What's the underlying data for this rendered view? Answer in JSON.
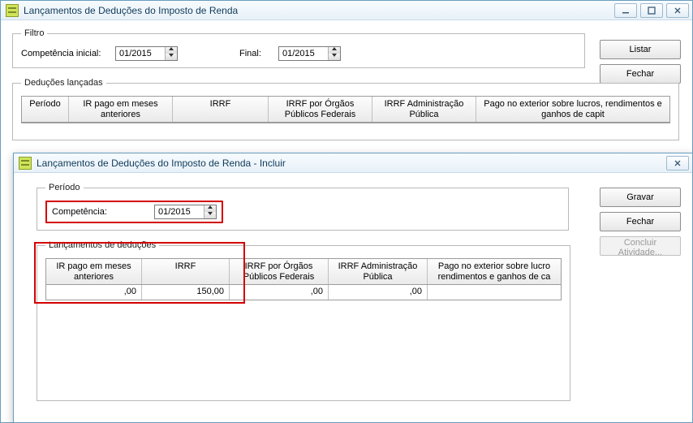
{
  "parent": {
    "title": "Lançamentos de Deduções do Imposto de Renda",
    "filter": {
      "legend": "Filtro",
      "initial_label": "Competência inicial:",
      "initial_value": "01/2015",
      "final_label": "Final:",
      "final_value": "01/2015"
    },
    "buttons": {
      "list": "Listar",
      "close": "Fechar"
    },
    "launches": {
      "legend": "Deduções lançadas",
      "headers": {
        "periodo": "Período",
        "ir_prev": "IR pago em meses anteriores",
        "irrf": "IRRF",
        "irrf_orgaos": "IRRF por Órgãos Públicos Federais",
        "irrf_admin": "IRRF Administração Pública",
        "pago_ext": "Pago no exterior sobre lucros, rendimentos e ganhos de capit"
      }
    }
  },
  "child": {
    "title": "Lançamentos de Deduções do Imposto de Renda - Incluir",
    "period": {
      "legend": "Período",
      "label": "Competência:",
      "value": "01/2015"
    },
    "buttons": {
      "save": "Gravar",
      "close": "Fechar",
      "conclude": "Concluir Atividade..."
    },
    "launches": {
      "legend": "Lançamentos de deduções",
      "headers": {
        "ir_prev": "IR pago em meses anteriores",
        "irrf": "IRRF",
        "irrf_orgaos": "IRRF por Órgãos Públicos Federais",
        "irrf_admin": "IRRF Administração Pública",
        "pago_ext": "Pago no exterior sobre lucro rendimentos e ganhos de ca"
      },
      "row": {
        "ir_prev": ",00",
        "irrf": "150,00",
        "irrf_orgaos": ",00",
        "irrf_admin": ",00",
        "pago_ext": ""
      }
    }
  }
}
